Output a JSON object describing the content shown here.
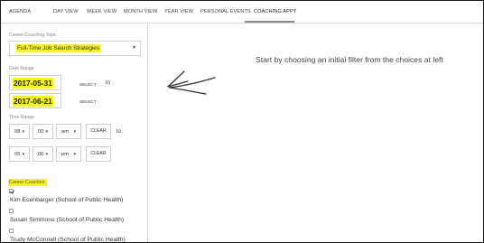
{
  "tabs": [
    {
      "label": "AGENDA"
    },
    {
      "label": "DAY VIEW"
    },
    {
      "label": "WEEK VIEW"
    },
    {
      "label": "MONTH VIEW"
    },
    {
      "label": "YEAR VIEW"
    },
    {
      "label": "PERSONAL EVENTS"
    },
    {
      "label": "COACHING APPT",
      "active": true
    }
  ],
  "filters": {
    "topic": {
      "label": "Career Coaching Topic",
      "selected": "Full-Time Job Search Strategies"
    },
    "date_range": {
      "label": "Date Range",
      "start": "2017-05-31",
      "end": "2017-06-21",
      "select_label": "SELECT",
      "to_label": "to"
    },
    "time_range": {
      "label": "Time Range",
      "start": {
        "hour": "08",
        "minute": "00",
        "ampm": "am"
      },
      "end": {
        "hour": "05",
        "minute": "00",
        "ampm": "pm"
      },
      "clear_label": "CLEAR",
      "to_label": "to"
    },
    "coaches": {
      "label": "Career Coaches:",
      "items": [
        {
          "name": "Kim Ecenbarger (School of Public Health)",
          "checked": true
        },
        {
          "name": "Susan Simmons (School of Public Health)",
          "checked": false
        },
        {
          "name": "Trudy McConnell (School of Public Health)",
          "checked": false
        }
      ]
    }
  },
  "main": {
    "prompt": "Start by choosing an initial filter from the choices at left",
    "arrow_icon": "hand-drawn-arrow-left-icon"
  },
  "colors": {
    "highlight": "#f7f51c",
    "border": "#cfcfcf",
    "underline": "#8a8a8a"
  }
}
